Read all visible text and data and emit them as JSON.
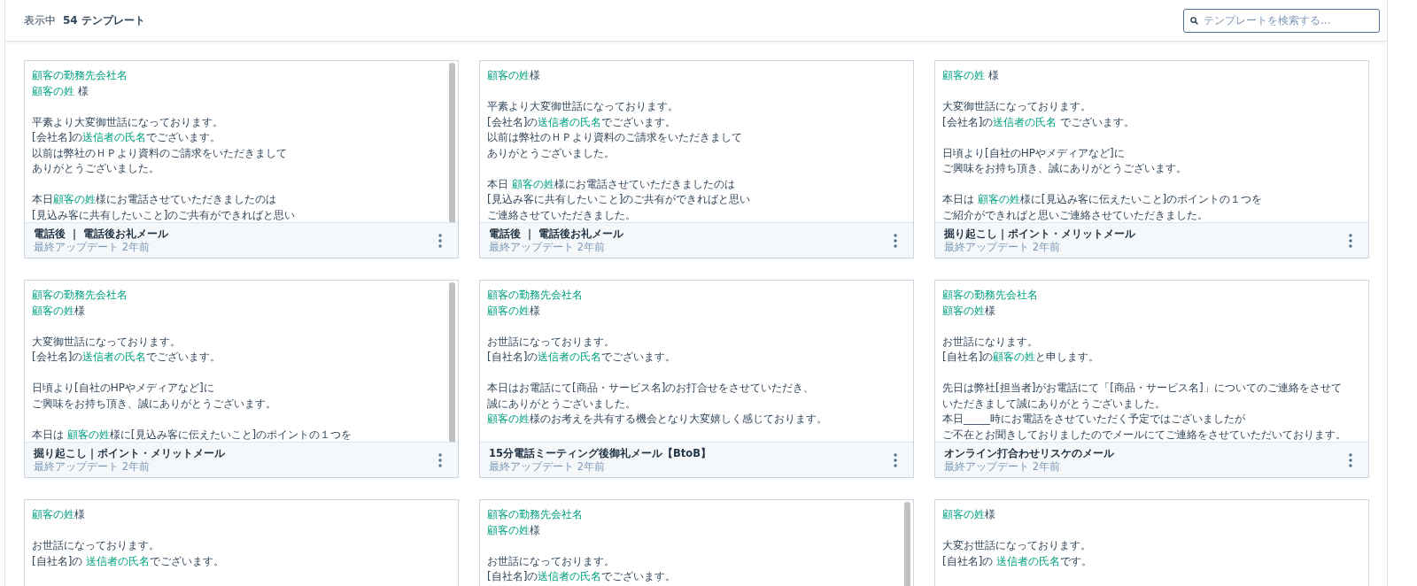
{
  "header": {
    "count_label": "表示中",
    "count": "54 テンプレート",
    "search": {
      "placeholder": "テンプレートを検索する..."
    }
  },
  "templates": [
    {
      "scrollbar": true,
      "paragraphs": [
        [
          [
            {
              "text": "顧客の勤務先会社名",
              "token": true
            }
          ],
          [
            {
              "text": "顧客の姓",
              "token": true
            },
            {
              "text": " 様",
              "token": false
            }
          ]
        ],
        [
          [
            {
              "text": "平素より大変御世話になっております。",
              "token": false
            }
          ],
          [
            {
              "text": "[会社名]の",
              "token": false
            },
            {
              "text": "送信者の氏名",
              "token": true
            },
            {
              "text": "でございます。",
              "token": false
            }
          ],
          [
            {
              "text": "以前は弊社のＨＰより資料のご請求をいただきまして",
              "token": false
            }
          ],
          [
            {
              "text": "ありがとうございました。",
              "token": false
            }
          ]
        ],
        [
          [
            {
              "text": "本日",
              "token": false
            },
            {
              "text": "顧客の姓",
              "token": true
            },
            {
              "text": "様にお電話させていただきましたのは",
              "token": false
            }
          ],
          [
            {
              "text": "[見込み客に共有したいこと]のご共有ができればと思い",
              "token": false
            }
          ]
        ]
      ],
      "title": "電話後 ｜ 電話後お礼メール",
      "updated": "最終アップデート 2年前"
    },
    {
      "scrollbar": false,
      "paragraphs": [
        [
          [
            {
              "text": "顧客の姓",
              "token": true
            },
            {
              "text": "様",
              "token": false
            }
          ]
        ],
        [
          [
            {
              "text": "平素より大変御世話になっております。",
              "token": false
            }
          ],
          [
            {
              "text": "[会社名]の",
              "token": false
            },
            {
              "text": "送信者の氏名",
              "token": true
            },
            {
              "text": "でございます。",
              "token": false
            }
          ],
          [
            {
              "text": "以前は弊社のＨＰより資料のご請求をいただきまして",
              "token": false
            }
          ],
          [
            {
              "text": "ありがとうございました。",
              "token": false
            }
          ]
        ],
        [
          [
            {
              "text": "本日 ",
              "token": false
            },
            {
              "text": "顧客の姓",
              "token": true
            },
            {
              "text": "様にお電話させていただきましたのは",
              "token": false
            }
          ],
          [
            {
              "text": "[見込み客に共有したいこと]のご共有ができればと思い",
              "token": false
            }
          ],
          [
            {
              "text": "ご連絡させていただきました。",
              "token": false
            }
          ]
        ]
      ],
      "title": "電話後 ｜ 電話後お礼メール",
      "updated": "最終アップデート 2年前"
    },
    {
      "scrollbar": false,
      "paragraphs": [
        [
          [
            {
              "text": "顧客の姓",
              "token": true
            },
            {
              "text": " 様",
              "token": false
            }
          ]
        ],
        [
          [
            {
              "text": "大変御世話になっております。",
              "token": false
            }
          ],
          [
            {
              "text": "[会社名]の",
              "token": false
            },
            {
              "text": "送信者の氏名",
              "token": true
            },
            {
              "text": " でございます。",
              "token": false
            }
          ]
        ],
        [
          [
            {
              "text": "日頃より[自社のHPやメディアなど]に",
              "token": false
            }
          ],
          [
            {
              "text": "ご興味をお持ち頂き、誠にありがとうございます。",
              "token": false
            }
          ]
        ],
        [
          [
            {
              "text": "本日は ",
              "token": false
            },
            {
              "text": "顧客の姓",
              "token": true
            },
            {
              "text": "様に[見込み客に伝えたいこと]のポイントの１つを",
              "token": false
            }
          ],
          [
            {
              "text": "ご紹介ができればと思いご連絡させていただきました。",
              "token": false
            }
          ]
        ]
      ],
      "title": "掘り起こし｜ポイント・メリットメール",
      "updated": "最終アップデート 2年前"
    },
    {
      "scrollbar": true,
      "paragraphs": [
        [
          [
            {
              "text": "顧客の勤務先会社名",
              "token": true
            }
          ],
          [
            {
              "text": "顧客の姓",
              "token": true
            },
            {
              "text": "様",
              "token": false
            }
          ]
        ],
        [
          [
            {
              "text": "大変御世話になっております。",
              "token": false
            }
          ],
          [
            {
              "text": "[会社名]の",
              "token": false
            },
            {
              "text": "送信者の氏名",
              "token": true
            },
            {
              "text": "でございます。",
              "token": false
            }
          ]
        ],
        [
          [
            {
              "text": "日頃より[自社のHPやメディアなど]に",
              "token": false
            }
          ],
          [
            {
              "text": "ご興味をお持ち頂き、誠にありがとうございます。",
              "token": false
            }
          ]
        ],
        [
          [
            {
              "text": "本日は ",
              "token": false
            },
            {
              "text": "顧客の姓",
              "token": true
            },
            {
              "text": "様に[見込み客に伝えたいこと]のポイントの１つを",
              "token": false
            }
          ]
        ]
      ],
      "title": "掘り起こし｜ポイント・メリットメール",
      "updated": "最終アップデート 2年前"
    },
    {
      "scrollbar": false,
      "paragraphs": [
        [
          [
            {
              "text": "顧客の勤務先会社名",
              "token": true
            }
          ],
          [
            {
              "text": "顧客の姓",
              "token": true
            },
            {
              "text": "様",
              "token": false
            }
          ]
        ],
        [
          [
            {
              "text": "お世話になっております。",
              "token": false
            }
          ],
          [
            {
              "text": "[自社名]の",
              "token": false
            },
            {
              "text": "送信者の氏名",
              "token": true
            },
            {
              "text": "でございます。",
              "token": false
            }
          ]
        ],
        [
          [
            {
              "text": "本日はお電話にて[商品・サービス名]のお打合せをさせていただき、",
              "token": false
            }
          ],
          [
            {
              "text": "誠にありがとうございました。",
              "token": false
            }
          ],
          [
            {
              "text": "顧客の姓",
              "token": true
            },
            {
              "text": "様のお考えを共有する機会となり大変嬉しく感じております。",
              "token": false
            }
          ]
        ]
      ],
      "title": "15分電話ミーティング後御礼メール【BtoB】",
      "updated": "最終アップデート 2年前"
    },
    {
      "scrollbar": false,
      "paragraphs": [
        [
          [
            {
              "text": "顧客の勤務先会社名",
              "token": true
            }
          ],
          [
            {
              "text": "顧客の姓",
              "token": true
            },
            {
              "text": "様",
              "token": false
            }
          ]
        ],
        [
          [
            {
              "text": "お世話になります。",
              "token": false
            }
          ],
          [
            {
              "text": "[自社名]の",
              "token": false
            },
            {
              "text": "顧客の姓",
              "token": true
            },
            {
              "text": "と申します。",
              "token": false
            }
          ]
        ],
        [
          [
            {
              "text": "先日は弊社[担当者]がお電話にて「[商品・サービス名]」についてのご連絡をさせて",
              "token": false
            }
          ],
          [
            {
              "text": "いただきまして誠にありがとうございました。",
              "token": false
            }
          ],
          [
            {
              "text": "本日_____時にお電話をさせていただく予定ではございましたが",
              "token": false
            }
          ],
          [
            {
              "text": "ご不在とお聞きしておりましたのでメールにてご連絡をさせていただいております。",
              "token": false
            }
          ]
        ]
      ],
      "title": "オンライン打合わせリスケのメール",
      "updated": "最終アップデート 2年前"
    },
    {
      "scrollbar": false,
      "paragraphs": [
        [
          [
            {
              "text": "顧客の姓",
              "token": true
            },
            {
              "text": "様",
              "token": false
            }
          ]
        ],
        [
          [
            {
              "text": "お世話になっております。",
              "token": false
            }
          ],
          [
            {
              "text": "[自社名]の ",
              "token": false
            },
            {
              "text": "送信者の氏名",
              "token": true
            },
            {
              "text": "でございます。",
              "token": false
            }
          ]
        ]
      ]
    },
    {
      "scrollbar": true,
      "paragraphs": [
        [
          [
            {
              "text": "顧客の勤務先会社名",
              "token": true
            }
          ],
          [
            {
              "text": "顧客の姓",
              "token": true
            },
            {
              "text": "様",
              "token": false
            }
          ]
        ],
        [
          [
            {
              "text": "お世話になっております。",
              "token": false
            }
          ],
          [
            {
              "text": "[自社名]の",
              "token": false
            },
            {
              "text": "送信者の氏名",
              "token": true
            },
            {
              "text": "でございます。",
              "token": false
            }
          ]
        ]
      ]
    },
    {
      "scrollbar": false,
      "paragraphs": [
        [
          [
            {
              "text": "顧客の姓",
              "token": true
            },
            {
              "text": "様",
              "token": false
            }
          ]
        ],
        [
          [
            {
              "text": "大変お世話になっております。",
              "token": false
            }
          ],
          [
            {
              "text": "[自社名]の ",
              "token": false
            },
            {
              "text": "送信者の氏名",
              "token": true
            },
            {
              "text": "です。",
              "token": false
            }
          ]
        ]
      ]
    }
  ]
}
